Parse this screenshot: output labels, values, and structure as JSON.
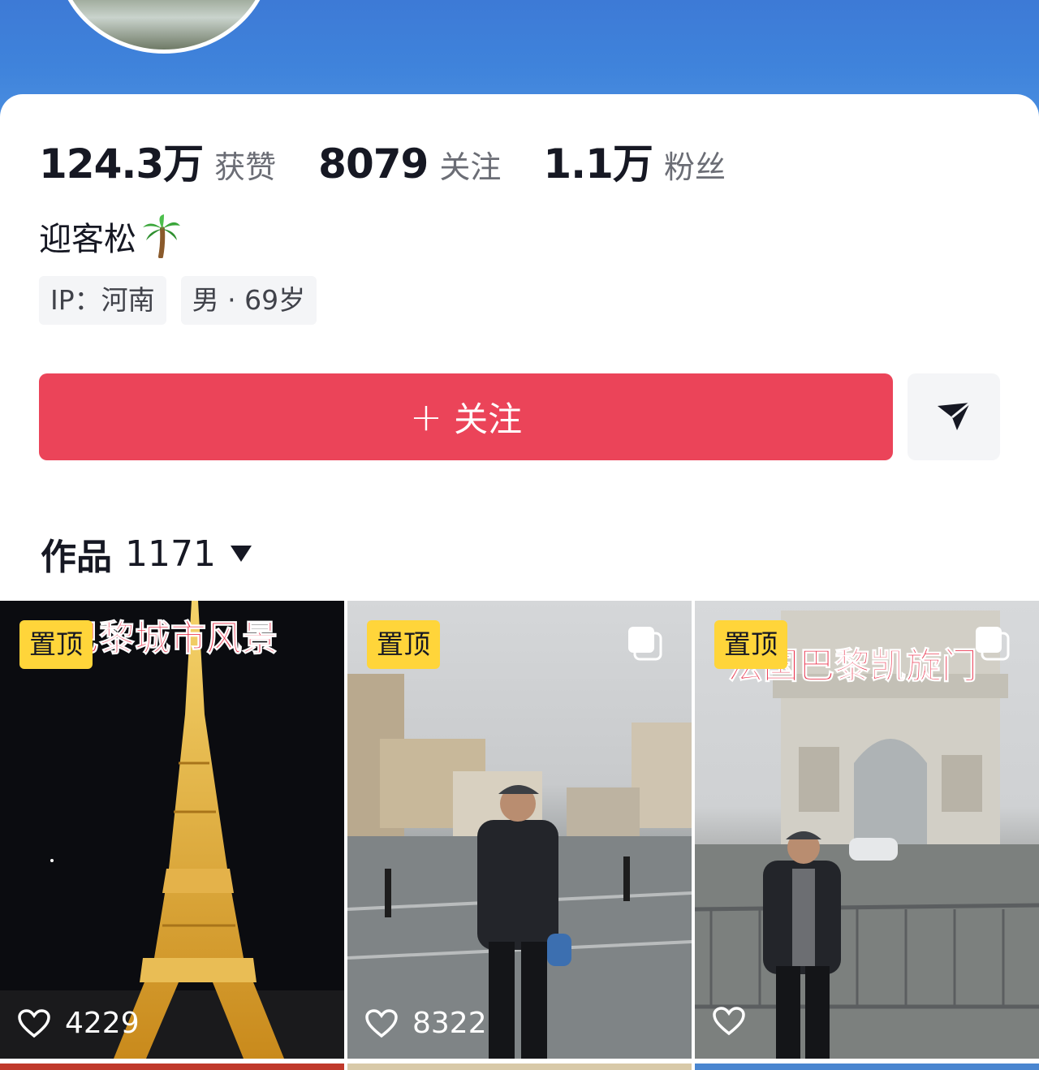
{
  "profile": {
    "stats": [
      {
        "value": "124.3万",
        "label": "获赞"
      },
      {
        "value": "8079",
        "label": "关注"
      },
      {
        "value": "1.1万",
        "label": "粉丝"
      }
    ],
    "name": "迎客松",
    "tags": [
      "IP：河南",
      "男 · 69岁"
    ]
  },
  "actions": {
    "follow_plus": "+",
    "follow_label": "关注",
    "share_icon": "send-icon"
  },
  "works": {
    "label": "作品",
    "count": "1171"
  },
  "videos": [
    {
      "pinned_label": "置顶",
      "caption": "巴黎城市风景",
      "likes": "4229",
      "multi": false
    },
    {
      "pinned_label": "置顶",
      "caption": "",
      "likes": "8322",
      "multi": true
    },
    {
      "pinned_label": "置顶",
      "caption": "法国巴黎凯旋门",
      "likes": "",
      "multi": true
    }
  ],
  "colors": {
    "header_blue": "#3f83db",
    "follow_red": "#eb4459",
    "pin_yellow": "#ffd53a",
    "caption_red": "#e8334d"
  }
}
